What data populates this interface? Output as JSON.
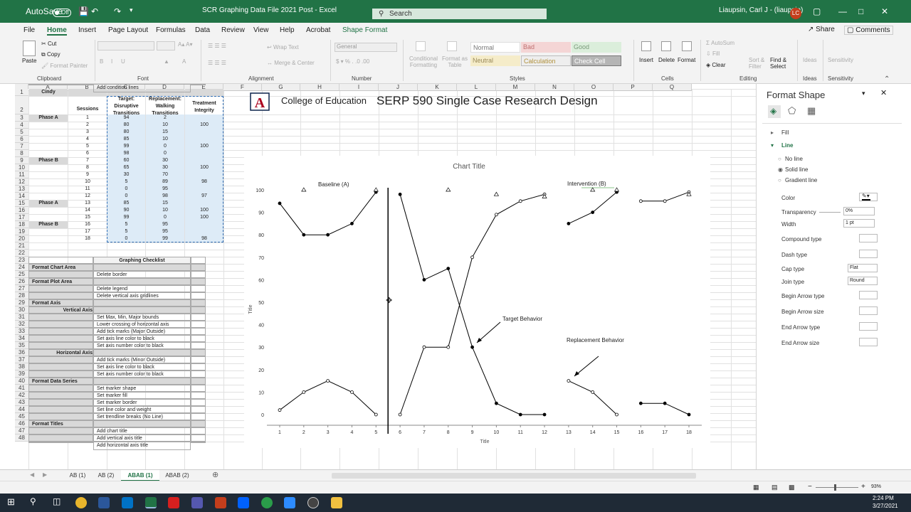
{
  "titlebar": {
    "autosave": "AutoSave",
    "autosave_state": "Off",
    "filename": "SCR Graphing Data File 2021 Post  -  Excel",
    "search": "Search",
    "user": "Liaupsin, Carl J - (liaupsin)",
    "initials": "LC"
  },
  "menu": [
    "File",
    "Home",
    "Insert",
    "Page Layout",
    "Formulas",
    "Data",
    "Review",
    "View",
    "Help",
    "Acrobat",
    "Shape Format"
  ],
  "share": "Share",
  "comments": "Comments",
  "ribbon": {
    "clipboard": {
      "paste": "Paste",
      "cut": "Cut",
      "copy": "Copy",
      "painter": "Format Painter",
      "group": "Clipboard"
    },
    "font_group": "Font",
    "alignment": {
      "wrap": "Wrap Text",
      "merge": "Merge & Center",
      "group": "Alignment"
    },
    "number": {
      "format": "General",
      "group": "Number"
    },
    "styles": {
      "cond": "Conditional Formatting",
      "table": "Format as Table",
      "group": "Styles",
      "normal": "Normal",
      "bad": "Bad",
      "good": "Good",
      "neutral": "Neutral",
      "calc": "Calculation",
      "check": "Check Cell"
    },
    "cells": {
      "insert": "Insert",
      "delete": "Delete",
      "format": "Format",
      "group": "Cells"
    },
    "editing": {
      "autosum": "AutoSum",
      "fill": "Fill",
      "clear": "Clear",
      "sort": "Sort & Filter",
      "find": "Find & Select",
      "group": "Editing"
    },
    "ideas": {
      "label": "Ideas",
      "group": "Ideas"
    },
    "sensitivity": {
      "label": "Sensitivity",
      "group": "Sensitivity"
    }
  },
  "columns": [
    "A",
    "B",
    "C",
    "D",
    "E",
    "F",
    "G",
    "H",
    "I",
    "J",
    "K",
    "L",
    "M",
    "N",
    "O",
    "P",
    "Q"
  ],
  "rows": [
    "1",
    "2",
    "3",
    "4",
    "5",
    "6",
    "7",
    "8",
    "9",
    "10",
    "11",
    "12",
    "13",
    "14",
    "15",
    "16",
    "17",
    "18",
    "19",
    "20",
    "21",
    "22",
    "23",
    "24",
    "25",
    "26",
    "27",
    "28",
    "29",
    "30",
    "31",
    "32",
    "33",
    "34",
    "35",
    "36",
    "37",
    "38",
    "39",
    "40",
    "41",
    "42",
    "43",
    "44",
    "45",
    "46",
    "47",
    "48"
  ],
  "sheet": {
    "name": "Cindy",
    "headers": {
      "sessions": "Sessions",
      "target": "Target: Disruptive Transitions",
      "replacement": "Replacement: Walking Transitions",
      "integrity": "Treatment Integrity"
    },
    "data": [
      [
        "Phase A",
        "1",
        "94",
        "2",
        ""
      ],
      [
        "",
        "2",
        "80",
        "10",
        "100"
      ],
      [
        "",
        "3",
        "80",
        "15",
        ""
      ],
      [
        "",
        "4",
        "85",
        "10",
        ""
      ],
      [
        "",
        "5",
        "99",
        "0",
        "100"
      ],
      [
        "",
        "6",
        "98",
        "0",
        ""
      ],
      [
        "Phase B",
        "7",
        "60",
        "30",
        ""
      ],
      [
        "",
        "8",
        "65",
        "30",
        "100"
      ],
      [
        "",
        "9",
        "30",
        "70",
        ""
      ],
      [
        "",
        "10",
        "5",
        "89",
        "98"
      ],
      [
        "",
        "11",
        "0",
        "95",
        ""
      ],
      [
        "",
        "12",
        "0",
        "98",
        "97"
      ],
      [
        "Phase A",
        "13",
        "85",
        "15",
        ""
      ],
      [
        "",
        "14",
        "90",
        "10",
        "100"
      ],
      [
        "",
        "15",
        "99",
        "0",
        "100"
      ],
      [
        "Phase B",
        "16",
        "5",
        "95",
        ""
      ],
      [
        "",
        "17",
        "5",
        "95",
        ""
      ],
      [
        "",
        "18",
        "0",
        "99",
        "98"
      ]
    ]
  },
  "checklist": {
    "title": "Graphing Checklist",
    "items": [
      {
        "s": "Format Chart Area",
        "t": ""
      },
      {
        "s": "",
        "t": "Delete border"
      },
      {
        "s": "Format Plot Area",
        "t": ""
      },
      {
        "s": "",
        "t": "Delete legend"
      },
      {
        "s": "",
        "t": "Delete vertical axis gridlines"
      },
      {
        "s": "Format Axis",
        "t": ""
      },
      {
        "s": "Vertical Axis",
        "t": ""
      },
      {
        "s": "",
        "t": "Set Max, Min, Major bounds"
      },
      {
        "s": "",
        "t": "Lower crossing of horizontal axis"
      },
      {
        "s": "",
        "t": "Add tick marks (Major Outside)"
      },
      {
        "s": "",
        "t": "Set axis line color to black"
      },
      {
        "s": "",
        "t": "Set axis number color to black"
      },
      {
        "s": "Horizontal Axis",
        "t": ""
      },
      {
        "s": "",
        "t": "Add tick marks (Minor Outside)"
      },
      {
        "s": "",
        "t": "Set axis line color to black"
      },
      {
        "s": "",
        "t": "Set axis number color to black"
      },
      {
        "s": "Format Data Series",
        "t": ""
      },
      {
        "s": "",
        "t": "Set marker shape"
      },
      {
        "s": "",
        "t": "Set marker fill"
      },
      {
        "s": "",
        "t": "Set marker border"
      },
      {
        "s": "",
        "t": "Set line color and weight"
      },
      {
        "s": "",
        "t": "Set trendline breaks (No Line)"
      },
      {
        "s": "Format Titles",
        "t": ""
      },
      {
        "s": "",
        "t": "Add chart title"
      },
      {
        "s": "",
        "t": "Add vertical axis title"
      },
      {
        "s": "",
        "t": "Add horizontal axis title"
      },
      {
        "s": "",
        "t": "Add condition lines"
      }
    ]
  },
  "banner": {
    "college": "College of Education",
    "course": "SERP 590 Single Case Research Design"
  },
  "chart_data": {
    "type": "line",
    "title": "Chart Title",
    "xlabel": "Title",
    "ylabel": "Title",
    "x": [
      1,
      2,
      3,
      4,
      5,
      6,
      7,
      8,
      9,
      10,
      11,
      12,
      13,
      14,
      15,
      16,
      17,
      18
    ],
    "ylim": [
      0,
      100
    ],
    "yticks": [
      0,
      10,
      20,
      30,
      40,
      50,
      60,
      70,
      80,
      90,
      100
    ],
    "series": [
      {
        "name": "Target Behavior",
        "values": [
          94,
          80,
          80,
          85,
          99,
          98,
          60,
          65,
          30,
          5,
          0,
          0,
          85,
          90,
          99,
          5,
          5,
          0
        ]
      },
      {
        "name": "Replacement Behavior",
        "values": [
          2,
          10,
          15,
          10,
          0,
          0,
          30,
          30,
          70,
          89,
          95,
          98,
          15,
          10,
          0,
          95,
          95,
          99
        ]
      }
    ],
    "integrity_markers": {
      "x": [
        2,
        5,
        8,
        10,
        12,
        14,
        15,
        18
      ],
      "y": [
        100,
        100,
        100,
        98,
        97,
        100,
        100,
        98
      ]
    },
    "annotations": [
      "Baseline (A)",
      "Intervention (B)",
      "Target Behavior",
      "Replacement Behavior"
    ],
    "phase_line_after": 5
  },
  "panel": {
    "title": "Format Shape",
    "fill": "Fill",
    "line": "Line",
    "no_line": "No line",
    "solid_line": "Solid line",
    "gradient_line": "Gradient line",
    "color": "Color",
    "transparency": "Transparency",
    "transparency_val": "0%",
    "width": "Width",
    "width_val": "1 pt",
    "compound": "Compound type",
    "dash": "Dash type",
    "cap": "Cap type",
    "cap_val": "Flat",
    "join": "Join type",
    "join_val": "Round",
    "begin_arrow_type": "Begin Arrow type",
    "begin_arrow_size": "Begin Arrow size",
    "end_arrow_type": "End Arrow type",
    "end_arrow_size": "End Arrow size"
  },
  "tabs": [
    "AB (1)",
    "AB (2)",
    "ABAB (1)",
    "ABAB (2)"
  ],
  "status": {
    "zoom": "93%"
  },
  "clock": {
    "time": "2:24 PM",
    "date": "3/27/2021"
  }
}
